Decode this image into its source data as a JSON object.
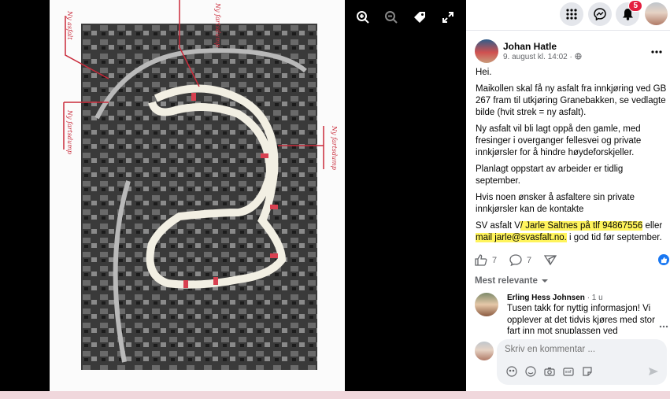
{
  "viewer": {
    "photo_annotations": [
      "Ny asfalt",
      "Ny fartsdump",
      "Ny fartsdump",
      "Ny fartsdump"
    ]
  },
  "topbar": {
    "notifications_count": "5"
  },
  "post": {
    "author": "Johan Hatle",
    "timestamp": "9. august kl. 14:02 ·",
    "lines": {
      "greeting": "Hei.",
      "p1": "Maikollen skal få ny asfalt fra innkjøring ved GB 267 fram til utkjøring Granebakken, se vedlagte bilde (hvit strek = ny asfalt).",
      "p2": "Ny asfalt vil bli lagt oppå den gamle, med fresinger i overganger fellesvei og private innkjørsler for å hindre høydeforskjeller.",
      "p3": "Planlagt oppstart av arbeider er tidlig september.",
      "p4": "Hvis noen ønsker å asfaltere sin private innkjørsler kan de kontakte",
      "p5_a": "SV asfalt V",
      "p5_hl1": "/ Jarle Saltnes på tlf 94867556",
      "p5_b": " eller",
      "p5_hl2": "mail jarle@svasfalt.no.",
      "p5_c": " i god tid før september."
    },
    "likes": "7",
    "comments": "7",
    "sort_label": "Mest relevante"
  },
  "comment": {
    "author": "Erling Hess Johnsen",
    "age": "· 1 u",
    "text": "Tusen takk for nyttig informasjon! Vi opplever at det tidvis kjøres med stor fart inn mot snuplassen ved"
  },
  "composer": {
    "placeholder": "Skriv en kommentar ..."
  },
  "colors": {
    "accent": "#1877f2",
    "highlight": "#fff45c",
    "badge": "#e41e3f"
  }
}
